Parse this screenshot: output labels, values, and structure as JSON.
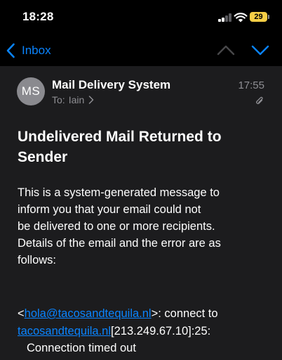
{
  "status_bar": {
    "time": "18:28",
    "battery_level": "29",
    "battery_color": "#f7ce46"
  },
  "nav": {
    "back_label": "Inbox",
    "back_icon": "chevron-left-icon",
    "up_icon": "chevron-up-icon",
    "down_icon": "chevron-down-icon",
    "accent_color": "#0a84ff"
  },
  "message": {
    "avatar_initials": "MS",
    "sender": "Mail Delivery System",
    "to_label": "To:",
    "recipient": "Iain",
    "time": "17:55",
    "attachment_icon": "paperclip-icon",
    "subject": "Undelivered Mail Returned to Sender",
    "body_lines": [
      "This is a system-generated message to",
      "inform you that your email could not",
      "be delivered to one or more recipients.",
      "Details of the email and the error are as",
      "follows:"
    ],
    "error": {
      "open_bracket": "<",
      "email_link": "hola@tacosandtequila.nl",
      "after_email": ">: connect to",
      "domain_link": "tacosandtequila.nl",
      "after_domain": "[213.249.67.10]:25:",
      "reason": "Connection timed out"
    }
  }
}
